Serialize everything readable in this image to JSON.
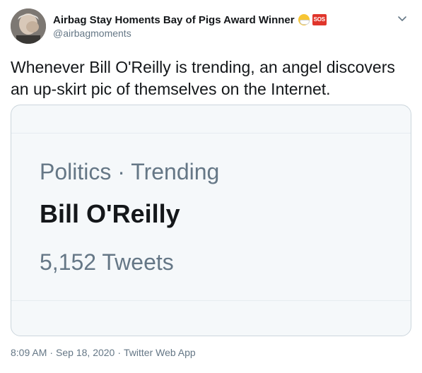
{
  "author": {
    "display_name": "Airbag Stay Homents Bay of Pigs Award Winner",
    "emojis": [
      "face-with-medical-mask-icon",
      "sos-button-icon"
    ],
    "sos_label": "SOS",
    "handle": "@airbagmoments"
  },
  "tweet": {
    "text": "Whenever Bill O'Reilly is trending, an angel discovers an up-skirt pic of themselves on the Internet."
  },
  "card": {
    "context": "Politics · Trending",
    "title": "Bill O'Reilly",
    "count": "5,152 Tweets"
  },
  "meta": {
    "time": "8:09 AM",
    "separator": "·",
    "date": "Sep 18, 2020",
    "source": "Twitter Web App"
  },
  "colors": {
    "text": "#14171a",
    "secondary": "#657786",
    "card_bg": "#f5f8fa",
    "border": "#ccd6dd"
  }
}
